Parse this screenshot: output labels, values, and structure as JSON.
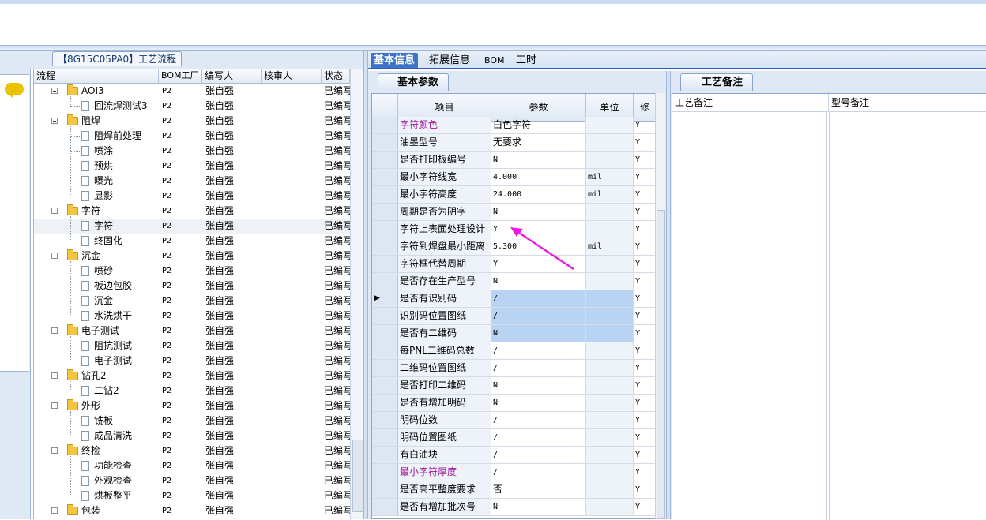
{
  "left_panel": {
    "tab_label": "【8G15C05PA0】工艺流程",
    "columns": [
      "流程",
      "BOM工厂",
      "编写人",
      "核审人",
      "状态"
    ],
    "rows": [
      {
        "name": "AOI3",
        "level": 1,
        "bom": "P2",
        "writer": "张自强",
        "status": "已编写"
      },
      {
        "name": "回流焊测试3",
        "level": 2,
        "bom": "P2",
        "writer": "张自强",
        "status": "已编写"
      },
      {
        "name": "阻焊",
        "level": 1,
        "bom": "P2",
        "writer": "张自强",
        "status": "已编写"
      },
      {
        "name": "阻焊前处理",
        "level": 2,
        "bom": "P2",
        "writer": "张自强",
        "status": "已编写"
      },
      {
        "name": "喷涂",
        "level": 2,
        "bom": "P2",
        "writer": "张自强",
        "status": "已编写"
      },
      {
        "name": "预烘",
        "level": 2,
        "bom": "P2",
        "writer": "张自强",
        "status": "已编写"
      },
      {
        "name": "曝光",
        "level": 2,
        "bom": "P2",
        "writer": "张自强",
        "status": "已编写"
      },
      {
        "name": "显影",
        "level": 2,
        "bom": "P2",
        "writer": "张自强",
        "status": "已编写"
      },
      {
        "name": "字符",
        "level": 1,
        "bom": "P2",
        "writer": "张自强",
        "status": "已编写"
      },
      {
        "name": "字符",
        "level": 2,
        "bom": "P2",
        "writer": "张自强",
        "status": "已编写",
        "selected": true
      },
      {
        "name": "终固化",
        "level": 2,
        "bom": "P2",
        "writer": "张自强",
        "status": "已编写"
      },
      {
        "name": "沉金",
        "level": 1,
        "bom": "P2",
        "writer": "张自强",
        "status": "已编写"
      },
      {
        "name": "喷砂",
        "level": 2,
        "bom": "P2",
        "writer": "张自强",
        "status": "已编写"
      },
      {
        "name": "板边包胶",
        "level": 2,
        "bom": "P2",
        "writer": "张自强",
        "status": "已编写"
      },
      {
        "name": "沉金",
        "level": 2,
        "bom": "P2",
        "writer": "张自强",
        "status": "已编写"
      },
      {
        "name": "水洗烘干",
        "level": 2,
        "bom": "P2",
        "writer": "张自强",
        "status": "已编写"
      },
      {
        "name": "电子测试",
        "level": 1,
        "bom": "P2",
        "writer": "张自强",
        "status": "已编写"
      },
      {
        "name": "阻抗测试",
        "level": 2,
        "bom": "P2",
        "writer": "张自强",
        "status": "已编写"
      },
      {
        "name": "电子测试",
        "level": 2,
        "bom": "P2",
        "writer": "张自强",
        "status": "已编写"
      },
      {
        "name": "钻孔2",
        "level": 1,
        "bom": "P2",
        "writer": "张自强",
        "status": "已编写"
      },
      {
        "name": "二钻2",
        "level": 2,
        "bom": "P2",
        "writer": "张自强",
        "status": "已编写"
      },
      {
        "name": "外形",
        "level": 1,
        "bom": "P2",
        "writer": "张自强",
        "status": "已编写"
      },
      {
        "name": "铣板",
        "level": 2,
        "bom": "P2",
        "writer": "张自强",
        "status": "已编写"
      },
      {
        "name": "成品清洗",
        "level": 2,
        "bom": "P2",
        "writer": "张自强",
        "status": "已编写"
      },
      {
        "name": "终检",
        "level": 1,
        "bom": "P2",
        "writer": "张自强",
        "status": "已编写"
      },
      {
        "name": "功能检查",
        "level": 2,
        "bom": "P2",
        "writer": "张自强",
        "status": "已编写"
      },
      {
        "name": "外观检查",
        "level": 2,
        "bom": "P2",
        "writer": "张自强",
        "status": "已编写"
      },
      {
        "name": "烘板整平",
        "level": 2,
        "bom": "P2",
        "writer": "张自强",
        "status": "已编写"
      },
      {
        "name": "包装",
        "level": 1,
        "bom": "P2",
        "writer": "张自强",
        "status": "已编写"
      }
    ]
  },
  "main_tabs": [
    "基本信息",
    "拓展信息",
    "BOM",
    "工时"
  ],
  "basic_params": {
    "tab_label": "基本参数",
    "columns": [
      "项目",
      "参数",
      "单位",
      "修"
    ],
    "rows": [
      {
        "item": "字符颜色",
        "value": "白色字符",
        "unit": "",
        "flag": "Y",
        "highlight": true
      },
      {
        "item": "油墨型号",
        "value": "无要求",
        "unit": "",
        "flag": "Y"
      },
      {
        "item": "是否打印板编号",
        "value": "N",
        "unit": "",
        "flag": "Y"
      },
      {
        "item": "最小字符线宽",
        "value": "4.000",
        "unit": "mil",
        "flag": "Y"
      },
      {
        "item": "最小字符高度",
        "value": "24.000",
        "unit": "mil",
        "flag": "Y"
      },
      {
        "item": "周期是否为阴字",
        "value": "N",
        "unit": "",
        "flag": "Y"
      },
      {
        "item": "字符上表面处理设计",
        "value": "Y",
        "unit": "",
        "flag": "Y"
      },
      {
        "item": "字符到焊盘最小距离",
        "value": "5.300",
        "unit": "mil",
        "flag": "Y"
      },
      {
        "item": "字符框代替周期",
        "value": "Y",
        "unit": "",
        "flag": "Y"
      },
      {
        "item": "是否存在生产型号",
        "value": "N",
        "unit": "",
        "flag": "Y"
      },
      {
        "item": "是否有识别码",
        "value": "/",
        "unit": "",
        "flag": "Y",
        "current": true,
        "blue": true
      },
      {
        "item": "识别码位置图纸",
        "value": "/",
        "unit": "",
        "flag": "Y",
        "blue": true
      },
      {
        "item": "是否有二维码",
        "value": "N",
        "unit": "",
        "flag": "Y",
        "blue": true
      },
      {
        "item": "每PNL二维码总数",
        "value": "/",
        "unit": "",
        "flag": "Y"
      },
      {
        "item": "二维码位置图纸",
        "value": "/",
        "unit": "",
        "flag": "Y"
      },
      {
        "item": "是否打印二维码",
        "value": "N",
        "unit": "",
        "flag": "Y"
      },
      {
        "item": "是否有增加明码",
        "value": "N",
        "unit": "",
        "flag": "Y"
      },
      {
        "item": "明码位数",
        "value": "/",
        "unit": "",
        "flag": "Y"
      },
      {
        "item": "明码位置图纸",
        "value": "/",
        "unit": "",
        "flag": "Y"
      },
      {
        "item": "有白油块",
        "value": "/",
        "unit": "",
        "flag": "Y"
      },
      {
        "item": "最小字符厚度",
        "value": "/",
        "unit": "",
        "flag": "Y",
        "highlight": true
      },
      {
        "item": "是否高平整度要求",
        "value": "否",
        "unit": "",
        "flag": "Y"
      },
      {
        "item": "是否有增加批次号",
        "value": "N",
        "unit": "",
        "flag": "Y"
      }
    ]
  },
  "right_panel": {
    "tab_label": "工艺备注",
    "col1": "工艺备注",
    "col2": "型号备注"
  },
  "colors": {
    "highlight_text": "#a0189a",
    "selected_cell": "#b9d4f3",
    "arrow": "#e81ce0",
    "tab_active": "#3d74c8"
  }
}
